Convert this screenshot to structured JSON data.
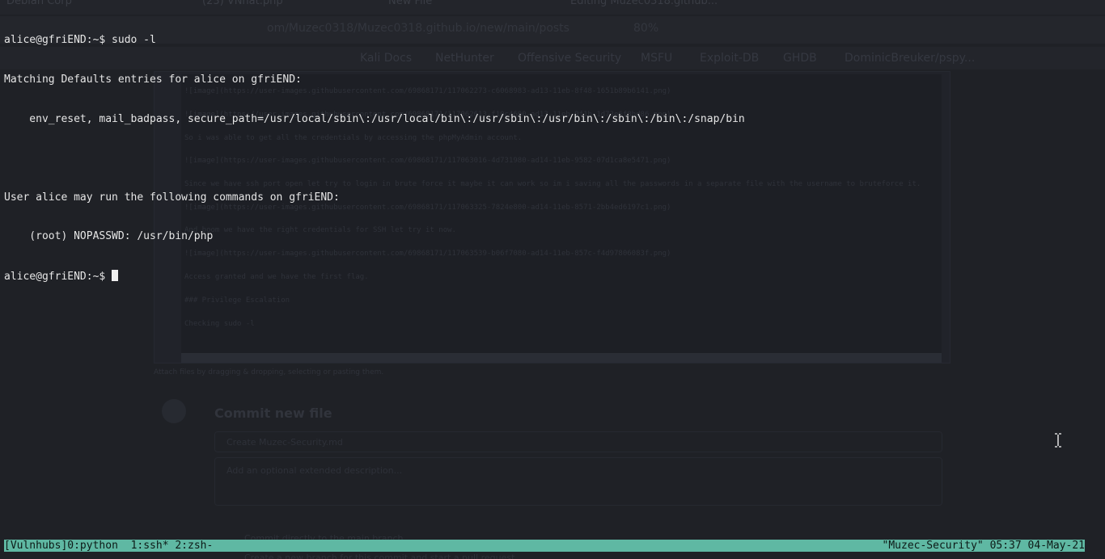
{
  "background": {
    "tabs": [
      "Debian Corp",
      "(23) VNhat.php",
      "New File",
      "Editing Muzec0318.github..."
    ],
    "url": "om/Muzec0318/Muzec0318.github.io/new/main/posts",
    "zoom": "80%",
    "bookmarks": [
      "Kali Docs",
      "NetHunter",
      "Offensive Security",
      "MSFU",
      "Exploit-DB",
      "GHDB",
      "DominicBreuker/pspy..."
    ],
    "editor_lines": [
      "![image](https://user-images.githubusercontent.com/69868171/117062273-c6068983-ad13-11eb-8f48-1651b89b6141.png)",
      "![image](https://user-images.githubusercontent.com/69868171/117062613-f10c4600-ad13-11eb-9f1b-1d73e6f8bd86.png)",
      "So i was able to get all the credentials by accessing the phpMyAdmin account.",
      "![image](https://user-images.githubusercontent.com/69868171/117063016-4d731980-ad14-11eb-9582-07d1ca8e5471.png)",
      "Since we have ssh port open let try to login in brute force it maybe it can work so im i saving all the passwords in a separate file with the username to bruteforce it.",
      "![image](https://user-images.githubusercontent.com/69868171/117063325-7824e800-ad14-11eb-8571-2bb4ed6197c1.png)",
      "And boom we have the right credentials for SSH let try it now.",
      "![image](https://user-images.githubusercontent.com/69868171/117063539-b06f7080-ad14-11eb-857c-f4d97806083f.png)",
      "Access granted and we have the first flag.",
      "### Privilege Escalation",
      "Checking sudo -l"
    ],
    "footer": "Attach files by dragging & dropping, selecting or pasting them.",
    "commit_title": "Commit new file",
    "commit_placeholder": "Create Muzec-Security.md",
    "commit_desc": "Add an optional extended description...",
    "radio_1": "Commit directly to the main branch.",
    "radio_2": "Create a new branch for this commit and start a pull request."
  },
  "terminal": {
    "lines": [
      "alice@gfriEND:~$ sudo -l",
      "Matching Defaults entries for alice on gfriEND:",
      "    env_reset, mail_badpass, secure_path=/usr/local/sbin\\:/usr/local/bin\\:/usr/sbin\\:/usr/bin\\:/sbin\\:/bin\\:/snap/bin",
      "",
      "User alice may run the following commands on gfriEND:",
      "    (root) NOPASSWD: /usr/bin/php"
    ],
    "prompt": "alice@gfriEND:~$ "
  },
  "tmux": {
    "session": "[Vulnhubs]",
    "windows": [
      "0:python",
      "1:ssh*",
      "2:zsh-"
    ],
    "host": "\"Muzec-Security\"",
    "time": "05:37",
    "date": "04-May-21"
  },
  "colors": {
    "status_bg": "#5fb8a3",
    "terminal_bg": "#1f2126",
    "terminal_fg": "#e6e6e6"
  }
}
